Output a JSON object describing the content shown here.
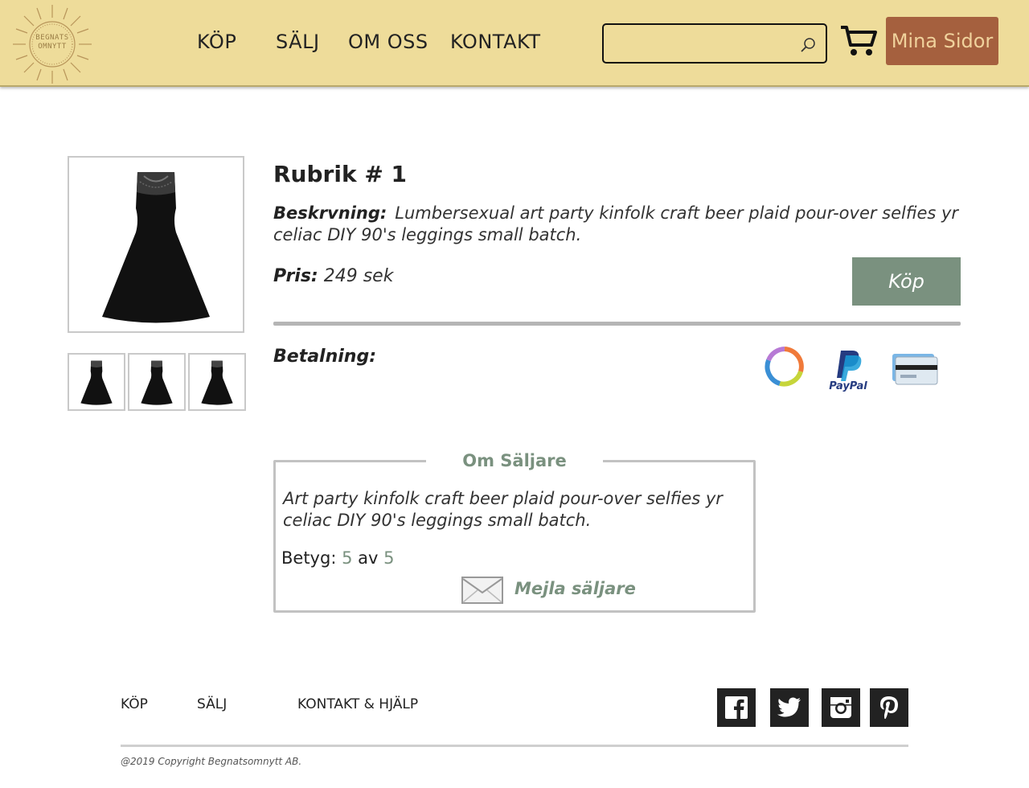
{
  "header": {
    "logo_text": [
      "BEGNATS",
      "OMNYTT"
    ],
    "nav": [
      "KÖP",
      "SÄLJ",
      "OM OSS",
      "KONTAKT"
    ],
    "search_placeholder": "",
    "my_pages_label": "Mina Sidor"
  },
  "product": {
    "title": "Rubrik # 1",
    "description_label": "Beskrvning:",
    "description": "Lumbersexual art party kinfolk craft beer plaid pour-over selfies yr celiac DIY 90's leggings small batch.",
    "price_label": "Pris:",
    "price": "249 sek",
    "buy_label": "Köp",
    "payment_label": "Betalning:",
    "payment_methods": [
      "swish-icon",
      "paypal-icon",
      "credit-card-icon"
    ],
    "paypal_text": "PayPal"
  },
  "seller": {
    "heading": "Om Säljare",
    "text": "Art party kinfolk craft beer plaid pour-over selfies yr celiac DIY 90's leggings small batch.",
    "rating_label": "Betyg:",
    "rating_value": "5",
    "rating_of": "av",
    "rating_max": "5",
    "mail_label": "Mejla säljare"
  },
  "footer": {
    "links": [
      "KÖP",
      "SÄLJ",
      "KONTAKT & HJÄLP"
    ],
    "social": [
      "facebook-icon",
      "twitter-icon",
      "instagram-icon",
      "pinterest-icon"
    ],
    "copyright": "@2019 Copyright Begnatsomnytt AB."
  },
  "colors": {
    "header_bg": "#eedc9a",
    "accent_green": "#7a917f",
    "button_brown": "#a5603e"
  }
}
